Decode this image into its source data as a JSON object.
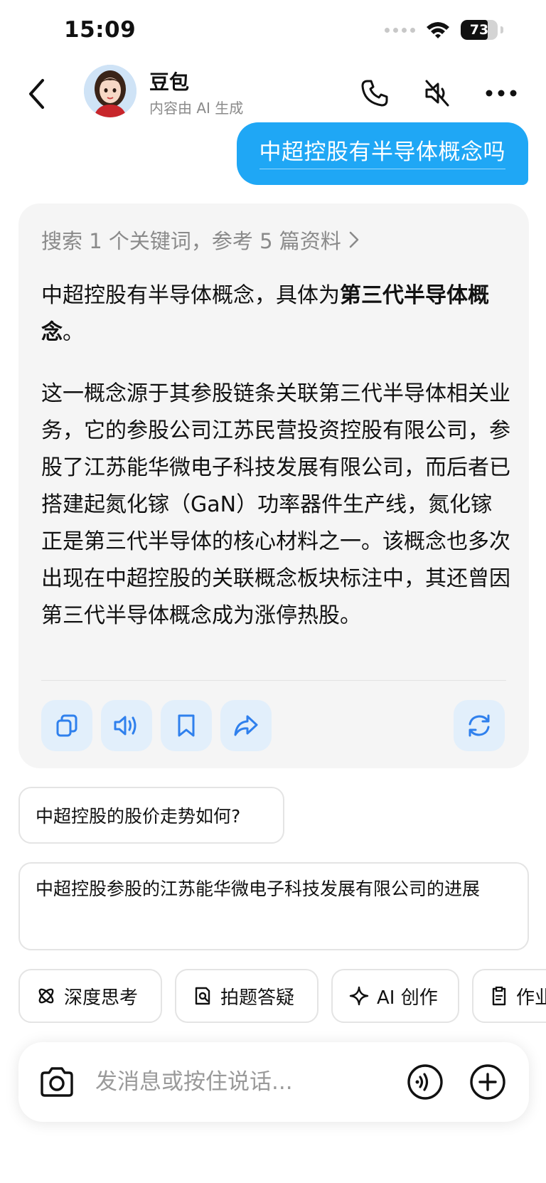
{
  "status_bar": {
    "time": "15:09",
    "battery": "73",
    "battery_level": 0.73
  },
  "header": {
    "title": "豆包",
    "subtitle": "内容由 AI 生成",
    "icons": [
      "back-arrow-icon",
      "phone-icon",
      "speaker-muted-icon",
      "more-icon"
    ]
  },
  "conversation": {
    "user_message": "中超控股有半导体概念吗",
    "answer": {
      "search_summary": "搜索 1 个关键词，参考 5 篇资料",
      "para1_prefix": "中超控股有半导体概念，具体为",
      "para1_bold": "第三代半导体概念",
      "para1_suffix": "。",
      "para2": "这一概念源于其参股链条关联第三代半导体相关业务，它的参股公司江苏民营投资控股有限公司，参股了江苏能华微电子科技发展有限公司，而后者已搭建起氮化镓（GaN）功率器件生产线，氮化镓正是第三代半导体的核心材料之一。该概念也多次出现在中超控股的关联概念板块标注中，其还曾因第三代半导体概念成为涨停热股。",
      "actions": [
        "copy-icon",
        "speaker-icon",
        "bookmark-icon",
        "share-icon",
        "regenerate-icon"
      ]
    },
    "suggestions": [
      "中超控股的股价走势如何?",
      "中超控股参股的江苏能华微电子科技发展有限公司的进展"
    ]
  },
  "tools": [
    {
      "label": "深度思考",
      "icon": "atom-icon"
    },
    {
      "label": "拍题答疑",
      "icon": "doc-search-icon"
    },
    {
      "label": "AI 创作",
      "icon": "sparkle-icon"
    },
    {
      "label": "作业",
      "icon": "homework-icon"
    }
  ],
  "composer": {
    "placeholder": "发消息或按住说话...",
    "icons": [
      "camera-icon",
      "voice-call-icon",
      "add-icon"
    ]
  },
  "colors": {
    "accent": "#1fa7f5",
    "card_bg": "#f5f5f5",
    "action_bg": "#e2effb",
    "action_icon": "#2f80ed"
  }
}
